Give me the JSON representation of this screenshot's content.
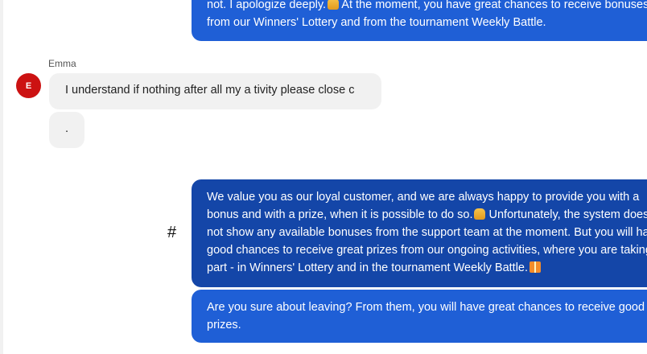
{
  "messages": {
    "agent_top": {
      "line1": "not. I apologize deeply.",
      "line1b": "At the moment, you have great chances to receive bonuses",
      "line2": "from our Winners' Lottery and from the tournament Weekly Battle."
    },
    "user": {
      "name": "Emma",
      "avatar_initial": "E",
      "message1": "I understand if nothing after all my a tivity please close c",
      "message2": "."
    },
    "agent_main": {
      "line1": "We value you as our loyal customer, and we are always happy to provide you with a",
      "line2a": "bonus and with a prize, when it is possible to do so.",
      "line2b": "Unfortunately, the system does",
      "line3": "not show any available bonuses from the support team at the moment. But you will have",
      "line4": "good chances to receive great prizes from our ongoing activities, where you are taking",
      "line5": "part - in Winners' Lottery and in the tournament Weekly Battle."
    },
    "agent_bottom": {
      "line1": "Are you sure about leaving? From them, you will have great chances to receive good",
      "line2": "prizes."
    }
  },
  "hash_symbol": "#",
  "icons": {
    "pray": "folded-hands-emoji",
    "gift": "gift-emoji",
    "cursor": "mouse-pointer"
  },
  "colors": {
    "agent_bubble": "#1f5fd6",
    "agent_bubble_dark": "#1446a8",
    "user_bubble": "#f1f1f1",
    "avatar": "#cc1212"
  }
}
